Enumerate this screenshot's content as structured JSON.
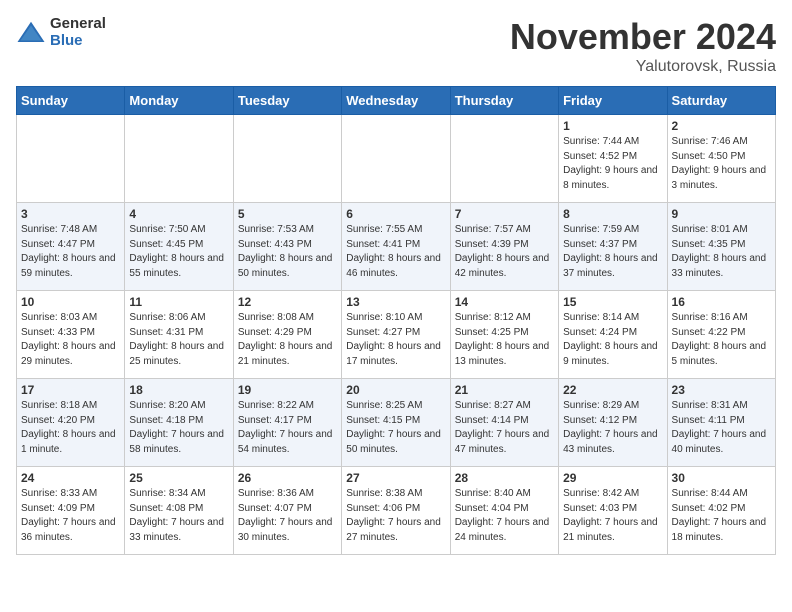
{
  "logo": {
    "general": "General",
    "blue": "Blue"
  },
  "title": {
    "month_year": "November 2024",
    "location": "Yalutorovsk, Russia"
  },
  "weekdays": [
    "Sunday",
    "Monday",
    "Tuesday",
    "Wednesday",
    "Thursday",
    "Friday",
    "Saturday"
  ],
  "weeks": [
    [
      {
        "day": "",
        "sunrise": "",
        "sunset": "",
        "daylight": ""
      },
      {
        "day": "",
        "sunrise": "",
        "sunset": "",
        "daylight": ""
      },
      {
        "day": "",
        "sunrise": "",
        "sunset": "",
        "daylight": ""
      },
      {
        "day": "",
        "sunrise": "",
        "sunset": "",
        "daylight": ""
      },
      {
        "day": "",
        "sunrise": "",
        "sunset": "",
        "daylight": ""
      },
      {
        "day": "1",
        "sunrise": "Sunrise: 7:44 AM",
        "sunset": "Sunset: 4:52 PM",
        "daylight": "Daylight: 9 hours and 8 minutes."
      },
      {
        "day": "2",
        "sunrise": "Sunrise: 7:46 AM",
        "sunset": "Sunset: 4:50 PM",
        "daylight": "Daylight: 9 hours and 3 minutes."
      }
    ],
    [
      {
        "day": "3",
        "sunrise": "Sunrise: 7:48 AM",
        "sunset": "Sunset: 4:47 PM",
        "daylight": "Daylight: 8 hours and 59 minutes."
      },
      {
        "day": "4",
        "sunrise": "Sunrise: 7:50 AM",
        "sunset": "Sunset: 4:45 PM",
        "daylight": "Daylight: 8 hours and 55 minutes."
      },
      {
        "day": "5",
        "sunrise": "Sunrise: 7:53 AM",
        "sunset": "Sunset: 4:43 PM",
        "daylight": "Daylight: 8 hours and 50 minutes."
      },
      {
        "day": "6",
        "sunrise": "Sunrise: 7:55 AM",
        "sunset": "Sunset: 4:41 PM",
        "daylight": "Daylight: 8 hours and 46 minutes."
      },
      {
        "day": "7",
        "sunrise": "Sunrise: 7:57 AM",
        "sunset": "Sunset: 4:39 PM",
        "daylight": "Daylight: 8 hours and 42 minutes."
      },
      {
        "day": "8",
        "sunrise": "Sunrise: 7:59 AM",
        "sunset": "Sunset: 4:37 PM",
        "daylight": "Daylight: 8 hours and 37 minutes."
      },
      {
        "day": "9",
        "sunrise": "Sunrise: 8:01 AM",
        "sunset": "Sunset: 4:35 PM",
        "daylight": "Daylight: 8 hours and 33 minutes."
      }
    ],
    [
      {
        "day": "10",
        "sunrise": "Sunrise: 8:03 AM",
        "sunset": "Sunset: 4:33 PM",
        "daylight": "Daylight: 8 hours and 29 minutes."
      },
      {
        "day": "11",
        "sunrise": "Sunrise: 8:06 AM",
        "sunset": "Sunset: 4:31 PM",
        "daylight": "Daylight: 8 hours and 25 minutes."
      },
      {
        "day": "12",
        "sunrise": "Sunrise: 8:08 AM",
        "sunset": "Sunset: 4:29 PM",
        "daylight": "Daylight: 8 hours and 21 minutes."
      },
      {
        "day": "13",
        "sunrise": "Sunrise: 8:10 AM",
        "sunset": "Sunset: 4:27 PM",
        "daylight": "Daylight: 8 hours and 17 minutes."
      },
      {
        "day": "14",
        "sunrise": "Sunrise: 8:12 AM",
        "sunset": "Sunset: 4:25 PM",
        "daylight": "Daylight: 8 hours and 13 minutes."
      },
      {
        "day": "15",
        "sunrise": "Sunrise: 8:14 AM",
        "sunset": "Sunset: 4:24 PM",
        "daylight": "Daylight: 8 hours and 9 minutes."
      },
      {
        "day": "16",
        "sunrise": "Sunrise: 8:16 AM",
        "sunset": "Sunset: 4:22 PM",
        "daylight": "Daylight: 8 hours and 5 minutes."
      }
    ],
    [
      {
        "day": "17",
        "sunrise": "Sunrise: 8:18 AM",
        "sunset": "Sunset: 4:20 PM",
        "daylight": "Daylight: 8 hours and 1 minute."
      },
      {
        "day": "18",
        "sunrise": "Sunrise: 8:20 AM",
        "sunset": "Sunset: 4:18 PM",
        "daylight": "Daylight: 7 hours and 58 minutes."
      },
      {
        "day": "19",
        "sunrise": "Sunrise: 8:22 AM",
        "sunset": "Sunset: 4:17 PM",
        "daylight": "Daylight: 7 hours and 54 minutes."
      },
      {
        "day": "20",
        "sunrise": "Sunrise: 8:25 AM",
        "sunset": "Sunset: 4:15 PM",
        "daylight": "Daylight: 7 hours and 50 minutes."
      },
      {
        "day": "21",
        "sunrise": "Sunrise: 8:27 AM",
        "sunset": "Sunset: 4:14 PM",
        "daylight": "Daylight: 7 hours and 47 minutes."
      },
      {
        "day": "22",
        "sunrise": "Sunrise: 8:29 AM",
        "sunset": "Sunset: 4:12 PM",
        "daylight": "Daylight: 7 hours and 43 minutes."
      },
      {
        "day": "23",
        "sunrise": "Sunrise: 8:31 AM",
        "sunset": "Sunset: 4:11 PM",
        "daylight": "Daylight: 7 hours and 40 minutes."
      }
    ],
    [
      {
        "day": "24",
        "sunrise": "Sunrise: 8:33 AM",
        "sunset": "Sunset: 4:09 PM",
        "daylight": "Daylight: 7 hours and 36 minutes."
      },
      {
        "day": "25",
        "sunrise": "Sunrise: 8:34 AM",
        "sunset": "Sunset: 4:08 PM",
        "daylight": "Daylight: 7 hours and 33 minutes."
      },
      {
        "day": "26",
        "sunrise": "Sunrise: 8:36 AM",
        "sunset": "Sunset: 4:07 PM",
        "daylight": "Daylight: 7 hours and 30 minutes."
      },
      {
        "day": "27",
        "sunrise": "Sunrise: 8:38 AM",
        "sunset": "Sunset: 4:06 PM",
        "daylight": "Daylight: 7 hours and 27 minutes."
      },
      {
        "day": "28",
        "sunrise": "Sunrise: 8:40 AM",
        "sunset": "Sunset: 4:04 PM",
        "daylight": "Daylight: 7 hours and 24 minutes."
      },
      {
        "day": "29",
        "sunrise": "Sunrise: 8:42 AM",
        "sunset": "Sunset: 4:03 PM",
        "daylight": "Daylight: 7 hours and 21 minutes."
      },
      {
        "day": "30",
        "sunrise": "Sunrise: 8:44 AM",
        "sunset": "Sunset: 4:02 PM",
        "daylight": "Daylight: 7 hours and 18 minutes."
      }
    ]
  ]
}
